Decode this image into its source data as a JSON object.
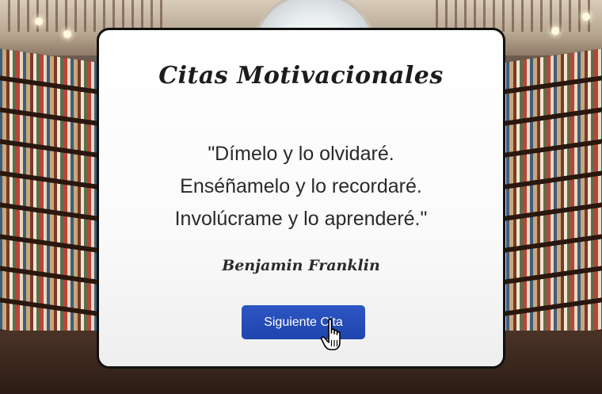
{
  "card": {
    "title": "Citas Motivacionales",
    "quote_lines": [
      "\"Dímelo y lo olvidaré.",
      "Enséñamelo y lo recordaré.",
      "Involúcrame y lo aprenderé.\""
    ],
    "author": "Benjamin Franklin",
    "next_button_label": "Siguiente Cita"
  },
  "cursor": {
    "icon": "hand-pointer-icon"
  },
  "colors": {
    "button": "#2250b8",
    "card_border": "#111111",
    "card_background": "#ffffff"
  }
}
